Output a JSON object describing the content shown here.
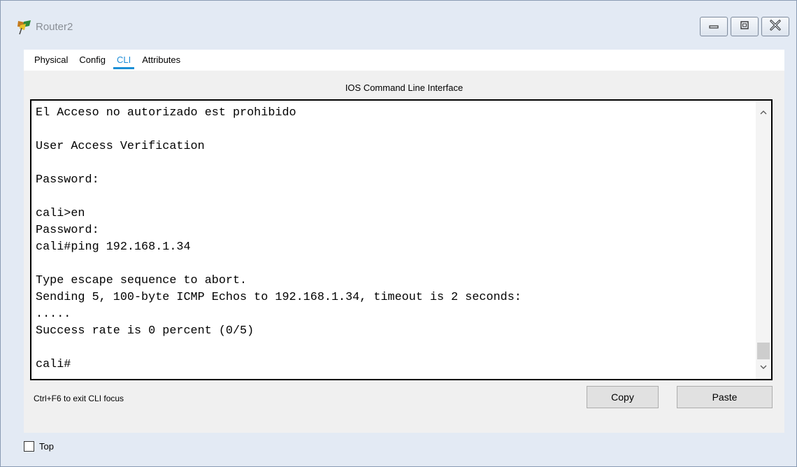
{
  "window": {
    "title": "Router2",
    "buttons": [
      "minimize",
      "maximize",
      "close"
    ]
  },
  "tabs": [
    {
      "label": "Physical",
      "active": false
    },
    {
      "label": "Config",
      "active": false
    },
    {
      "label": "CLI",
      "active": true
    },
    {
      "label": "Attributes",
      "active": false
    }
  ],
  "cli": {
    "panel_title": "IOS Command Line Interface",
    "console_text": "El Acceso no autorizado est prohibido\n\nUser Access Verification\n\nPassword:\n\ncali>en\nPassword:\ncali#ping 192.168.1.34\n\nType escape sequence to abort.\nSending 5, 100-byte ICMP Echos to 192.168.1.34, timeout is 2 seconds:\n.....\nSuccess rate is 0 percent (0/5)\n\ncali#",
    "hint": "Ctrl+F6 to exit CLI focus",
    "copy_label": "Copy",
    "paste_label": "Paste"
  },
  "footer": {
    "top_label": "Top",
    "top_checked": false
  },
  "colors": {
    "accent": "#1b8fd6",
    "window_bg": "#e3eaf4",
    "panel_bg": "#f0f0f0"
  },
  "icons": [
    "router-app-icon",
    "minimize-icon",
    "maximize-icon",
    "close-icon",
    "scroll-up-icon",
    "scroll-down-icon"
  ]
}
